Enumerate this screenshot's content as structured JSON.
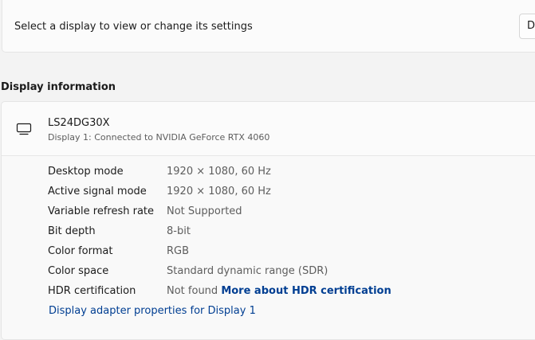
{
  "display_selection": {
    "label": "Select a display to view or change its settings",
    "identify_button_label": "D"
  },
  "display_info": {
    "heading": "Display information",
    "monitor": {
      "icon": "monitor-icon",
      "name": "LS24DG30X",
      "connection": "Display 1: Connected to NVIDIA GeForce RTX 4060"
    },
    "properties": [
      {
        "label": "Desktop mode",
        "value": "1920 × 1080, 60 Hz"
      },
      {
        "label": "Active signal mode",
        "value": "1920 × 1080, 60 Hz"
      },
      {
        "label": "Variable refresh rate",
        "value": "Not Supported"
      },
      {
        "label": "Bit depth",
        "value": "8-bit"
      },
      {
        "label": "Color format",
        "value": "RGB"
      },
      {
        "label": "Color space",
        "value": "Standard dynamic range (SDR)"
      },
      {
        "label": "HDR certification",
        "value": "Not found",
        "link": "More about HDR certification"
      }
    ],
    "adapter_link": "Display adapter properties for Display 1"
  },
  "colors": {
    "background": "#f3f3f3",
    "card": "#fbfbfb",
    "link": "#003e92",
    "secondary_text": "#5d5d5d"
  }
}
